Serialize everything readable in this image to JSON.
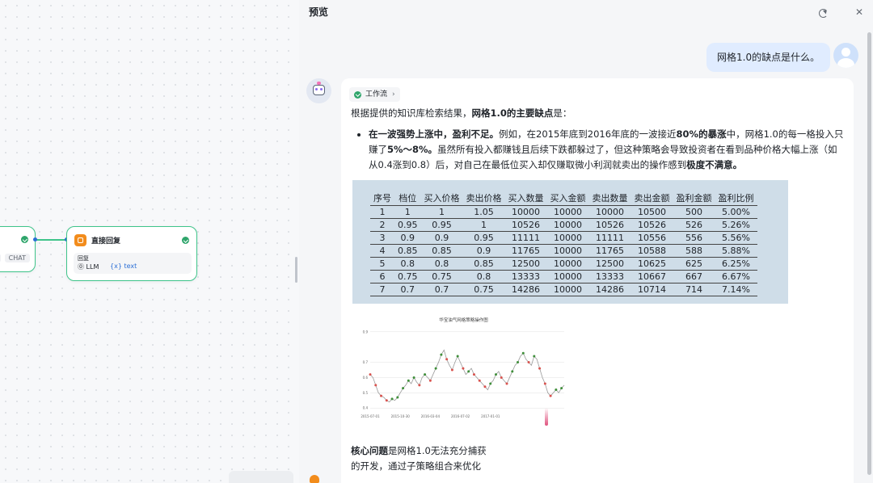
{
  "canvas": {
    "left_node": {
      "tags": [
        "...",
        "CHAT"
      ]
    },
    "reply_node": {
      "title": "直接回复",
      "box_label": "回复",
      "box_value": "⓪ LLM",
      "box_var": "{x} text"
    }
  },
  "panel": {
    "title": "预览",
    "user_message": "网格1.0的缺点是什么。",
    "workflow_tag": "工作流",
    "answer": {
      "intro_plain": "根据提供的知识库检索结果，",
      "intro_bold": "网格1.0的主要缺点",
      "intro_end": "是：",
      "bullet": {
        "b1": "在一波强势上涨中，盈利不足。",
        "t1": "例如，在2015年底到2016年底的一波接近",
        "b2": "80%的暴涨",
        "t2": "中，网格1.0的每一格投入只赚了",
        "b3": "5%～8%。",
        "t3": "虽然所有投入都赚钱且后续下跌都躲过了，但这种策略会导致投资者在看到品种价格大幅上涨（如从0.4涨到0.8）后，对自己在最低位买入却仅赚取微小利润就卖出的操作感到",
        "b4": "极度不满意。"
      },
      "footer_bold": "核心问题",
      "footer_text": "是网格1.0无法充分捕获",
      "footer_line2": "的开发，通过子策略组合来优化"
    },
    "table": {
      "headers": [
        "序号",
        "档位",
        "买入价格",
        "卖出价格",
        "买入数量",
        "买入金额",
        "卖出数量",
        "卖出金额",
        "盈利金额",
        "盈利比例"
      ],
      "rows": [
        [
          "1",
          "1",
          "1",
          "1.05",
          "10000",
          "10000",
          "10000",
          "10500",
          "500",
          "5.00%"
        ],
        [
          "2",
          "0.95",
          "0.95",
          "1",
          "10526",
          "10000",
          "10526",
          "10526",
          "526",
          "5.26%"
        ],
        [
          "3",
          "0.9",
          "0.9",
          "0.95",
          "11111",
          "10000",
          "11111",
          "10556",
          "556",
          "5.56%"
        ],
        [
          "4",
          "0.85",
          "0.85",
          "0.9",
          "11765",
          "10000",
          "11765",
          "10588",
          "588",
          "5.88%"
        ],
        [
          "5",
          "0.8",
          "0.8",
          "0.85",
          "12500",
          "10000",
          "12500",
          "10625",
          "625",
          "6.25%"
        ],
        [
          "6",
          "0.75",
          "0.75",
          "0.8",
          "13333",
          "10000",
          "13333",
          "10667",
          "667",
          "6.67%"
        ],
        [
          "7",
          "0.7",
          "0.7",
          "0.75",
          "14286",
          "10000",
          "14286",
          "10714",
          "714",
          "7.14%"
        ]
      ]
    }
  },
  "chart_data": {
    "type": "line",
    "title": "华宝油气网格策略操作图",
    "xlabel": "",
    "ylabel": "",
    "x_ticks": [
      "2015-07-01",
      "2015-10-30",
      "2016-03-04",
      "2016-07-02",
      "2017-01-01"
    ],
    "y_ticks": [
      "0.9",
      "0.7",
      "0.6",
      "0.5",
      "0.4"
    ],
    "ylim": [
      0.38,
      0.92
    ],
    "series": [
      {
        "values": [
          0.62,
          0.6,
          0.55,
          0.5,
          0.48,
          0.47,
          0.45,
          0.44,
          0.46,
          0.45,
          0.47,
          0.5,
          0.53,
          0.55,
          0.58,
          0.56,
          0.6,
          0.57,
          0.55,
          0.6,
          0.62,
          0.6,
          0.58,
          0.62,
          0.66,
          0.7,
          0.75,
          0.78,
          0.72,
          0.68,
          0.65,
          0.7,
          0.74,
          0.7,
          0.66,
          0.62,
          0.64,
          0.66,
          0.62,
          0.6,
          0.58,
          0.56,
          0.54,
          0.52,
          0.56,
          0.58,
          0.62,
          0.64,
          0.6,
          0.58,
          0.56,
          0.6,
          0.64,
          0.68,
          0.7,
          0.74,
          0.76,
          0.72,
          0.7,
          0.68,
          0.74,
          0.72,
          0.66,
          0.6,
          0.56,
          0.5,
          0.48,
          0.5,
          0.52,
          0.5,
          0.53,
          0.55
        ]
      }
    ],
    "colors": {
      "line": "#9a9a9a",
      "buy": "#d9534f",
      "sell": "#3f8f3a"
    }
  },
  "colors": {
    "accent": "#3ec48a",
    "user_bubble": "#e0ecff",
    "table_bg": "#cfdde8"
  }
}
